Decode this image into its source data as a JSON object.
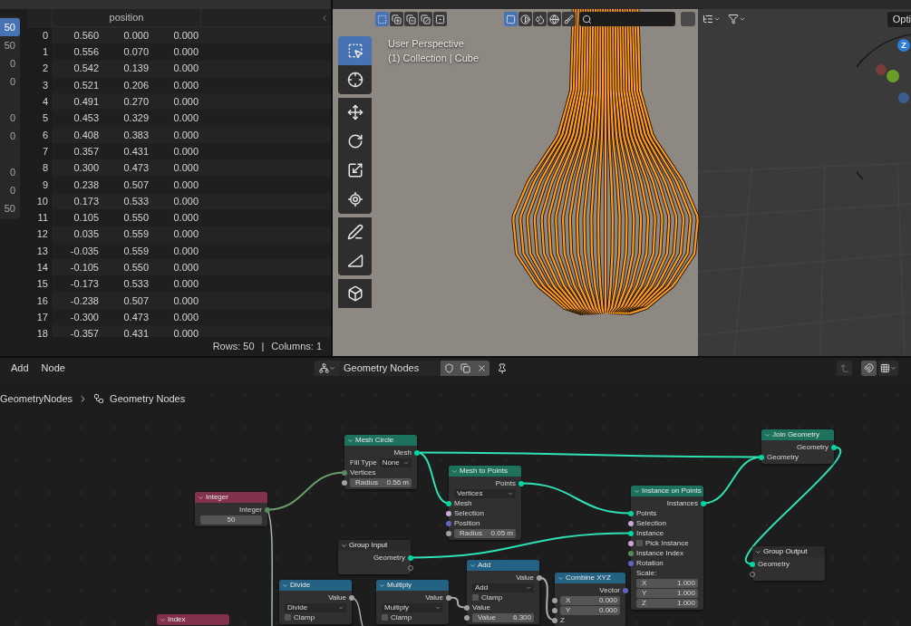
{
  "spreadsheet": {
    "domain_groups": [
      {
        "items": [
          {
            "value": "50",
            "selected": true
          },
          {
            "value": "50",
            "selected": false
          },
          {
            "value": "0",
            "selected": false
          },
          {
            "value": "0",
            "selected": false
          }
        ]
      },
      {
        "items": [
          {
            "value": "0",
            "selected": false
          },
          {
            "value": "0",
            "selected": false
          }
        ]
      },
      {
        "items": [
          {
            "value": "0",
            "selected": false
          },
          {
            "value": "0",
            "selected": false
          },
          {
            "value": "50",
            "selected": false
          }
        ]
      }
    ],
    "column": "position",
    "rows": [
      {
        "index": "0",
        "values": [
          "0.560",
          "0.000",
          "0.000"
        ]
      },
      {
        "index": "1",
        "values": [
          "0.556",
          "0.070",
          "0.000"
        ]
      },
      {
        "index": "2",
        "values": [
          "0.542",
          "0.139",
          "0.000"
        ]
      },
      {
        "index": "3",
        "values": [
          "0.521",
          "0.206",
          "0.000"
        ]
      },
      {
        "index": "4",
        "values": [
          "0.491",
          "0.270",
          "0.000"
        ]
      },
      {
        "index": "5",
        "values": [
          "0.453",
          "0.329",
          "0.000"
        ]
      },
      {
        "index": "6",
        "values": [
          "0.408",
          "0.383",
          "0.000"
        ]
      },
      {
        "index": "7",
        "values": [
          "0.357",
          "0.431",
          "0.000"
        ]
      },
      {
        "index": "8",
        "values": [
          "0.300",
          "0.473",
          "0.000"
        ]
      },
      {
        "index": "9",
        "values": [
          "0.238",
          "0.507",
          "0.000"
        ]
      },
      {
        "index": "10",
        "values": [
          "0.173",
          "0.533",
          "0.000"
        ]
      },
      {
        "index": "11",
        "values": [
          "0.105",
          "0.550",
          "0.000"
        ]
      },
      {
        "index": "12",
        "values": [
          "0.035",
          "0.559",
          "0.000"
        ]
      },
      {
        "index": "13",
        "values": [
          "-0.035",
          "0.559",
          "0.000"
        ]
      },
      {
        "index": "14",
        "values": [
          "-0.105",
          "0.550",
          "0.000"
        ]
      },
      {
        "index": "15",
        "values": [
          "-0.173",
          "0.533",
          "0.000"
        ]
      },
      {
        "index": "16",
        "values": [
          "-0.238",
          "0.507",
          "0.000"
        ]
      },
      {
        "index": "17",
        "values": [
          "-0.300",
          "0.473",
          "0.000"
        ]
      },
      {
        "index": "18",
        "values": [
          "-0.357",
          "0.431",
          "0.000"
        ]
      }
    ],
    "footer_rows": "Rows: 50",
    "footer_separator": "|",
    "footer_columns": "Columns: 1"
  },
  "viewport": {
    "select_modes": [
      {
        "selected": true
      },
      {
        "selected": false
      },
      {
        "selected": false
      },
      {
        "selected": false
      },
      {
        "selected": false
      }
    ],
    "shading_modes": [
      {
        "selected": true
      },
      {
        "selected": false
      },
      {
        "selected": false
      },
      {
        "selected": false
      },
      {
        "selected": false
      }
    ],
    "options_button": "Opti",
    "overlay_text": [
      "User Perspective",
      "(1) Collection | Cube"
    ],
    "tools": [
      {
        "selected": true
      },
      {
        "selected": false
      },
      {
        "selected": false
      },
      {
        "selected": false
      },
      {
        "selected": false
      },
      {
        "selected": false
      },
      {
        "selected": false
      },
      {
        "selected": false
      },
      {
        "selected": false
      }
    ],
    "gizmo_axis_label": "Z"
  },
  "node_editor": {
    "menus": [
      "Add",
      "Node"
    ],
    "node_group": "Geometry Nodes",
    "breadcrumb": [
      "GeometryNodes",
      "Geometry Nodes"
    ],
    "nodes": [
      {
        "title": "Mesh Circle",
        "kind": "geometry",
        "rows": [
          {
            "kind": "output",
            "label": "Mesh",
            "color": "#00d6a3"
          },
          {
            "kind": "dropdown",
            "label": "Fill Type",
            "value": "None"
          },
          {
            "kind": "input",
            "label": "Vertices",
            "color": "#598c5c"
          },
          {
            "kind": "field",
            "label": "Radius",
            "value": "0.56 m",
            "color": "#a1a1a1"
          }
        ]
      },
      {
        "title": "Mesh to Points",
        "kind": "geometry",
        "rows": [
          {
            "kind": "output",
            "label": "Points",
            "color": "#00d6a3"
          },
          {
            "kind": "dropdown",
            "value": "Vertices"
          },
          {
            "kind": "input",
            "label": "Mesh",
            "color": "#00d6a3"
          },
          {
            "kind": "input",
            "label": "Selection",
            "color": "#cca6d6"
          },
          {
            "kind": "input",
            "label": "Position",
            "color": "#6363c7"
          },
          {
            "kind": "field",
            "label": "Radius",
            "value": "0.05 m",
            "color": "#a1a1a1"
          }
        ]
      },
      {
        "title": "Integer",
        "kind": "input",
        "rows": [
          {
            "kind": "output",
            "label": "Integer",
            "color": "#598c5c"
          },
          {
            "kind": "field",
            "value": "50"
          }
        ]
      },
      {
        "title": "Group Input",
        "kind": "group",
        "rows": [
          {
            "kind": "output",
            "label": "Geometry",
            "color": "#00d6a3"
          },
          {
            "kind": "virtual_output"
          }
        ]
      },
      {
        "title": "Instance on Points",
        "kind": "geometry",
        "rows": [
          {
            "kind": "output",
            "label": "Instances",
            "color": "#00d6a3"
          },
          {
            "kind": "input",
            "label": "Points",
            "color": "#00d6a3"
          },
          {
            "kind": "input",
            "label": "Selection",
            "color": "#cca6d6"
          },
          {
            "kind": "input",
            "label": "Instance",
            "color": "#00d6a3"
          },
          {
            "kind": "checkbox",
            "label": "Pick Instance",
            "checked": false,
            "color": "#cca6d6"
          },
          {
            "kind": "input",
            "label": "Instance Index",
            "color": "#598c5c"
          },
          {
            "kind": "input",
            "label": "Rotation",
            "color": "#6363c7"
          },
          {
            "kind": "label",
            "label": "Scale:"
          },
          {
            "kind": "field",
            "label": "X",
            "value": "1.000"
          },
          {
            "kind": "field",
            "label": "Y",
            "value": "1.000"
          },
          {
            "kind": "field",
            "label": "Z",
            "value": "1.000"
          }
        ]
      },
      {
        "title": "Join Geometry",
        "kind": "geometry",
        "rows": [
          {
            "kind": "output",
            "label": "Geometry",
            "color": "#00d6a3"
          },
          {
            "kind": "input",
            "label": "Geometry",
            "color": "#00d6a3"
          }
        ]
      },
      {
        "title": "Group Output",
        "kind": "group",
        "rows": [
          {
            "kind": "input",
            "label": "Geometry",
            "color": "#00d6a3"
          },
          {
            "kind": "virtual_input"
          }
        ]
      },
      {
        "title": "Index",
        "kind": "input"
      },
      {
        "title": "Divide",
        "kind": "function",
        "rows": [
          {
            "kind": "output",
            "label": "Value",
            "color": "#a1a1a1"
          },
          {
            "kind": "dropdown",
            "value": "Divide"
          },
          {
            "kind": "checkbox",
            "label": "Clamp",
            "checked": false
          }
        ]
      },
      {
        "title": "Multiply",
        "kind": "function",
        "rows": [
          {
            "kind": "output",
            "label": "Value",
            "color": "#a1a1a1"
          },
          {
            "kind": "dropdown",
            "value": "Multiply"
          },
          {
            "kind": "checkbox",
            "label": "Clamp",
            "checked": false
          }
        ]
      },
      {
        "title": "Add",
        "kind": "function",
        "rows": [
          {
            "kind": "output",
            "label": "Value",
            "color": "#a1a1a1"
          },
          {
            "kind": "dropdown",
            "value": "Add"
          },
          {
            "kind": "checkbox",
            "label": "Clamp",
            "checked": false
          },
          {
            "kind": "input",
            "label": "Value",
            "color": "#a1a1a1"
          },
          {
            "kind": "field",
            "label": "Value",
            "value": "6.300",
            "color": "#a1a1a1"
          }
        ]
      },
      {
        "title": "Combine XYZ",
        "kind": "function",
        "rows": [
          {
            "kind": "output",
            "label": "Vector",
            "color": "#6363c7"
          },
          {
            "kind": "field",
            "label": "X",
            "value": "0.000",
            "color": "#a1a1a1"
          },
          {
            "kind": "field",
            "label": "Y",
            "value": "0.000",
            "color": "#a1a1a1"
          },
          {
            "kind": "input",
            "label": "Z",
            "color": "#a1a1a1"
          }
        ]
      }
    ]
  }
}
